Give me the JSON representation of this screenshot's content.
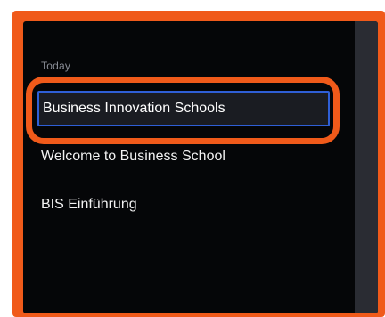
{
  "sidebar": {
    "section_label": "Today",
    "editing_item": {
      "value": "Business Innovation Schools"
    },
    "items": [
      {
        "label": "Welcome to Business School"
      },
      {
        "label": "BIS Einführung"
      }
    ]
  },
  "colors": {
    "highlight": "#f05a1a",
    "panel_background": "#050608",
    "input_border": "#2f5fd6",
    "text": "#f2f2f2",
    "muted_text": "#8a8d96"
  }
}
